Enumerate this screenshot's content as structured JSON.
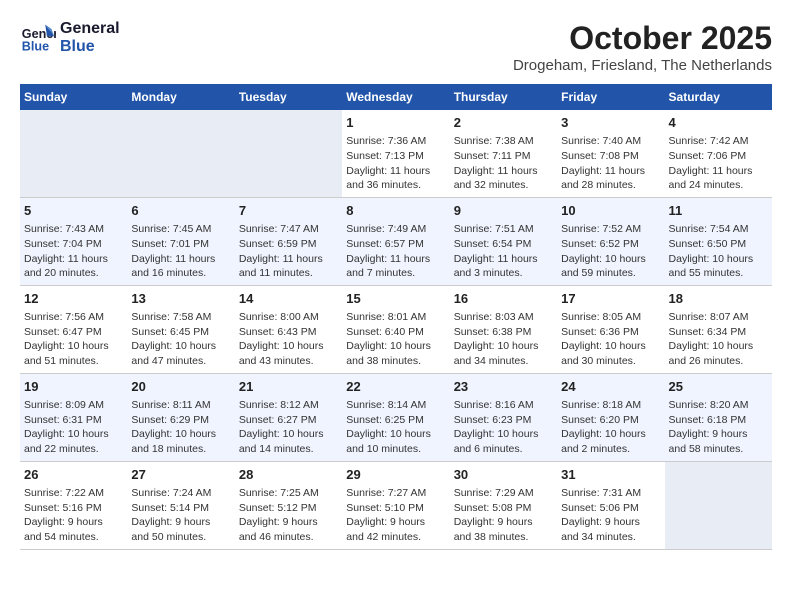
{
  "header": {
    "logo_line1": "General",
    "logo_line2": "Blue",
    "month": "October 2025",
    "location": "Drogeham, Friesland, The Netherlands"
  },
  "days_of_week": [
    "Sunday",
    "Monday",
    "Tuesday",
    "Wednesday",
    "Thursday",
    "Friday",
    "Saturday"
  ],
  "weeks": [
    [
      {
        "day": "",
        "info": ""
      },
      {
        "day": "",
        "info": ""
      },
      {
        "day": "",
        "info": ""
      },
      {
        "day": "1",
        "info": "Sunrise: 7:36 AM\nSunset: 7:13 PM\nDaylight: 11 hours\nand 36 minutes."
      },
      {
        "day": "2",
        "info": "Sunrise: 7:38 AM\nSunset: 7:11 PM\nDaylight: 11 hours\nand 32 minutes."
      },
      {
        "day": "3",
        "info": "Sunrise: 7:40 AM\nSunset: 7:08 PM\nDaylight: 11 hours\nand 28 minutes."
      },
      {
        "day": "4",
        "info": "Sunrise: 7:42 AM\nSunset: 7:06 PM\nDaylight: 11 hours\nand 24 minutes."
      }
    ],
    [
      {
        "day": "5",
        "info": "Sunrise: 7:43 AM\nSunset: 7:04 PM\nDaylight: 11 hours\nand 20 minutes."
      },
      {
        "day": "6",
        "info": "Sunrise: 7:45 AM\nSunset: 7:01 PM\nDaylight: 11 hours\nand 16 minutes."
      },
      {
        "day": "7",
        "info": "Sunrise: 7:47 AM\nSunset: 6:59 PM\nDaylight: 11 hours\nand 11 minutes."
      },
      {
        "day": "8",
        "info": "Sunrise: 7:49 AM\nSunset: 6:57 PM\nDaylight: 11 hours\nand 7 minutes."
      },
      {
        "day": "9",
        "info": "Sunrise: 7:51 AM\nSunset: 6:54 PM\nDaylight: 11 hours\nand 3 minutes."
      },
      {
        "day": "10",
        "info": "Sunrise: 7:52 AM\nSunset: 6:52 PM\nDaylight: 10 hours\nand 59 minutes."
      },
      {
        "day": "11",
        "info": "Sunrise: 7:54 AM\nSunset: 6:50 PM\nDaylight: 10 hours\nand 55 minutes."
      }
    ],
    [
      {
        "day": "12",
        "info": "Sunrise: 7:56 AM\nSunset: 6:47 PM\nDaylight: 10 hours\nand 51 minutes."
      },
      {
        "day": "13",
        "info": "Sunrise: 7:58 AM\nSunset: 6:45 PM\nDaylight: 10 hours\nand 47 minutes."
      },
      {
        "day": "14",
        "info": "Sunrise: 8:00 AM\nSunset: 6:43 PM\nDaylight: 10 hours\nand 43 minutes."
      },
      {
        "day": "15",
        "info": "Sunrise: 8:01 AM\nSunset: 6:40 PM\nDaylight: 10 hours\nand 38 minutes."
      },
      {
        "day": "16",
        "info": "Sunrise: 8:03 AM\nSunset: 6:38 PM\nDaylight: 10 hours\nand 34 minutes."
      },
      {
        "day": "17",
        "info": "Sunrise: 8:05 AM\nSunset: 6:36 PM\nDaylight: 10 hours\nand 30 minutes."
      },
      {
        "day": "18",
        "info": "Sunrise: 8:07 AM\nSunset: 6:34 PM\nDaylight: 10 hours\nand 26 minutes."
      }
    ],
    [
      {
        "day": "19",
        "info": "Sunrise: 8:09 AM\nSunset: 6:31 PM\nDaylight: 10 hours\nand 22 minutes."
      },
      {
        "day": "20",
        "info": "Sunrise: 8:11 AM\nSunset: 6:29 PM\nDaylight: 10 hours\nand 18 minutes."
      },
      {
        "day": "21",
        "info": "Sunrise: 8:12 AM\nSunset: 6:27 PM\nDaylight: 10 hours\nand 14 minutes."
      },
      {
        "day": "22",
        "info": "Sunrise: 8:14 AM\nSunset: 6:25 PM\nDaylight: 10 hours\nand 10 minutes."
      },
      {
        "day": "23",
        "info": "Sunrise: 8:16 AM\nSunset: 6:23 PM\nDaylight: 10 hours\nand 6 minutes."
      },
      {
        "day": "24",
        "info": "Sunrise: 8:18 AM\nSunset: 6:20 PM\nDaylight: 10 hours\nand 2 minutes."
      },
      {
        "day": "25",
        "info": "Sunrise: 8:20 AM\nSunset: 6:18 PM\nDaylight: 9 hours\nand 58 minutes."
      }
    ],
    [
      {
        "day": "26",
        "info": "Sunrise: 7:22 AM\nSunset: 5:16 PM\nDaylight: 9 hours\nand 54 minutes."
      },
      {
        "day": "27",
        "info": "Sunrise: 7:24 AM\nSunset: 5:14 PM\nDaylight: 9 hours\nand 50 minutes."
      },
      {
        "day": "28",
        "info": "Sunrise: 7:25 AM\nSunset: 5:12 PM\nDaylight: 9 hours\nand 46 minutes."
      },
      {
        "day": "29",
        "info": "Sunrise: 7:27 AM\nSunset: 5:10 PM\nDaylight: 9 hours\nand 42 minutes."
      },
      {
        "day": "30",
        "info": "Sunrise: 7:29 AM\nSunset: 5:08 PM\nDaylight: 9 hours\nand 38 minutes."
      },
      {
        "day": "31",
        "info": "Sunrise: 7:31 AM\nSunset: 5:06 PM\nDaylight: 9 hours\nand 34 minutes."
      },
      {
        "day": "",
        "info": ""
      }
    ]
  ]
}
